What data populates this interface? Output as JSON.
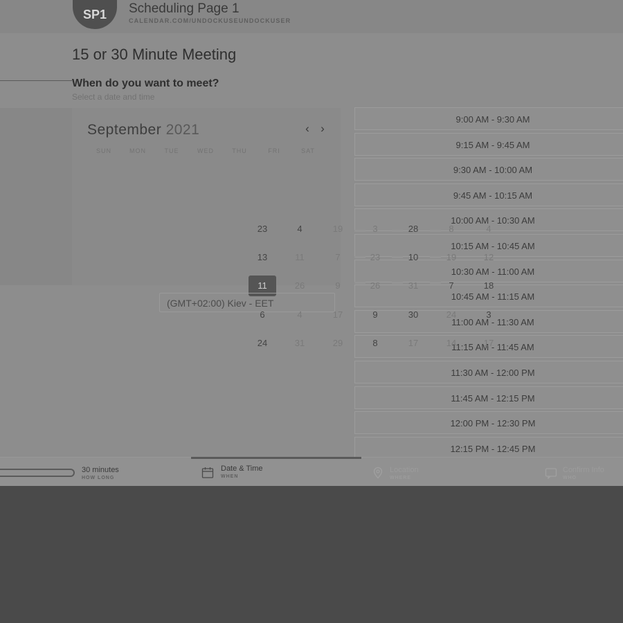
{
  "header": {
    "avatar": "SP1",
    "title": "Scheduling Page 1",
    "url": "CALENDAR.COM/UNDOCKUSEUNDOCKUSER"
  },
  "meeting": {
    "title": "15 or 30 Minute Meeting",
    "question": "When do you want to meet?",
    "subtitle": "Select a date and time"
  },
  "calendar": {
    "month": "September",
    "year": "2021",
    "prev_icon": "‹",
    "next_icon": "›",
    "weekdays": [
      "SUN",
      "MON",
      "TUE",
      "WED",
      "THU",
      "FRI",
      "SAT"
    ],
    "days": {
      "d23": "23",
      "d4": "4",
      "d19": "19",
      "d3": "3",
      "d28": "28",
      "d8": "8",
      "d4b": "4",
      "d13": "13",
      "d11": "11",
      "d7": "7",
      "d23b": "23",
      "d10": "10",
      "d19b": "19",
      "d12": "12",
      "d11sel": "11",
      "d26": "26",
      "d9": "9",
      "d26b": "26",
      "d31": "31",
      "d7b": "7",
      "d18": "18",
      "d6": "6",
      "d4c": "4",
      "d17": "17",
      "d9b": "9",
      "d30": "30",
      "d24": "24",
      "d3b": "3",
      "d24b": "24",
      "d31b": "31",
      "d29": "29",
      "d8b": "8",
      "d17b": "17",
      "d14": "14",
      "d17c": "17"
    },
    "timezone": "(GMT+02:00) Kiev - EET"
  },
  "time_slots": [
    "9:00 AM - 9:30 AM",
    "9:15 AM - 9:45 AM",
    "9:30 AM - 10:00 AM",
    "9:45 AM - 10:15 AM",
    "10:00 AM - 10:30 AM",
    "10:15 AM - 10:45 AM",
    "10:30 AM - 11:00 AM",
    "10:45 AM - 11:15 AM",
    "11:00 AM - 11:30 AM",
    "11:15 AM - 11:45 AM",
    "11:30 AM - 12:00 PM",
    "11:45 AM - 12:15 PM",
    "12:00 PM - 12:30 PM",
    "12:15 PM - 12:45 PM"
  ],
  "steps": [
    {
      "label": "30 minutes",
      "sub": "HOW LONG"
    },
    {
      "label": "Date & Time",
      "sub": "WHEN"
    },
    {
      "label": "Location",
      "sub": "WHERE"
    },
    {
      "label": "Confirm Info",
      "sub": "WHO"
    }
  ]
}
